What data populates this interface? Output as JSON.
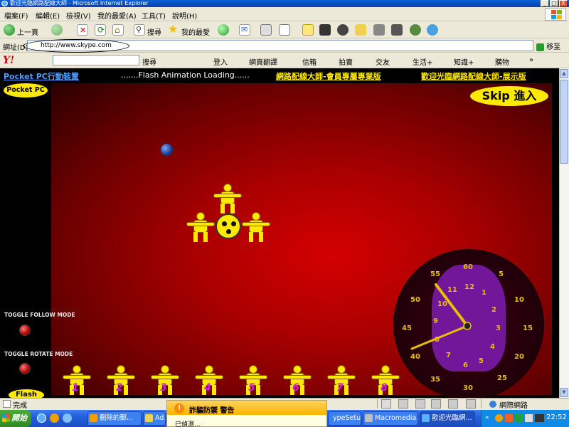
{
  "window": {
    "title": "歡迎光臨網路配線大師 - Microsoft Internet Explorer",
    "min": "_",
    "max": "□",
    "close": "X"
  },
  "menu": {
    "items": [
      "檔案(F)",
      "編輯(E)",
      "檢視(V)",
      "我的最愛(A)",
      "工具(T)",
      "說明(H)"
    ]
  },
  "toolbar": {
    "back": "上一頁",
    "search": "搜尋",
    "favorites": "我的最愛"
  },
  "address": {
    "label": "網址(D)",
    "url": "http://www.skype.com",
    "go": "移至"
  },
  "yahoo": {
    "logo": "Y!",
    "search_btn": "搜尋",
    "login": "登入",
    "translate": "網頁翻譯",
    "mail": "信箱",
    "auction": "拍賣",
    "friends": "交友",
    "life": "生活+",
    "knowledge": "知識+",
    "shopping": "購物",
    "more": "»"
  },
  "page": {
    "link_pocketpc": "Pocket PC行動裝置",
    "loading": ".......Flash Animation Loading......",
    "link_member": "網路配線大師-會員專屬專業版",
    "link_demo": "歡迎光臨網路配線大師-展示版",
    "pocketpc_badge": "Pocket PC",
    "skip_label": "Skip 進入",
    "toggle_follow": "TOGGLE FOLLOW MODE",
    "toggle_rotate": "TOGGLE ROTATE MODE",
    "flash_badge": "Flash",
    "figure_numbers": [
      "1",
      "2",
      "3",
      "4",
      "5",
      "6",
      "7",
      "8"
    ]
  },
  "clock": {
    "minute_marks": [
      "55",
      "60",
      "5",
      "10",
      "15",
      "20",
      "25",
      "30",
      "35",
      "40",
      "45",
      "50"
    ],
    "hour_marks": [
      "11",
      "12",
      "1",
      "2",
      "3",
      "4",
      "5",
      "6",
      "7",
      "8",
      "9",
      "10"
    ]
  },
  "status": {
    "text": "完成",
    "zone": "網際網路"
  },
  "taskbar": {
    "start": "開始",
    "tasks": [
      "刪除的郵...",
      "Ad...",
      "ypeSetup-...",
      "Macromedia...",
      "歡迎光臨網..."
    ],
    "time": "22:52"
  },
  "popup": {
    "title": "詐騙防禦 警告",
    "subtitle": "已偵測..."
  },
  "colors": {
    "accent_yellow": "#ffe900",
    "flash_red": "#d40000",
    "xp_blue": "#245edb"
  }
}
